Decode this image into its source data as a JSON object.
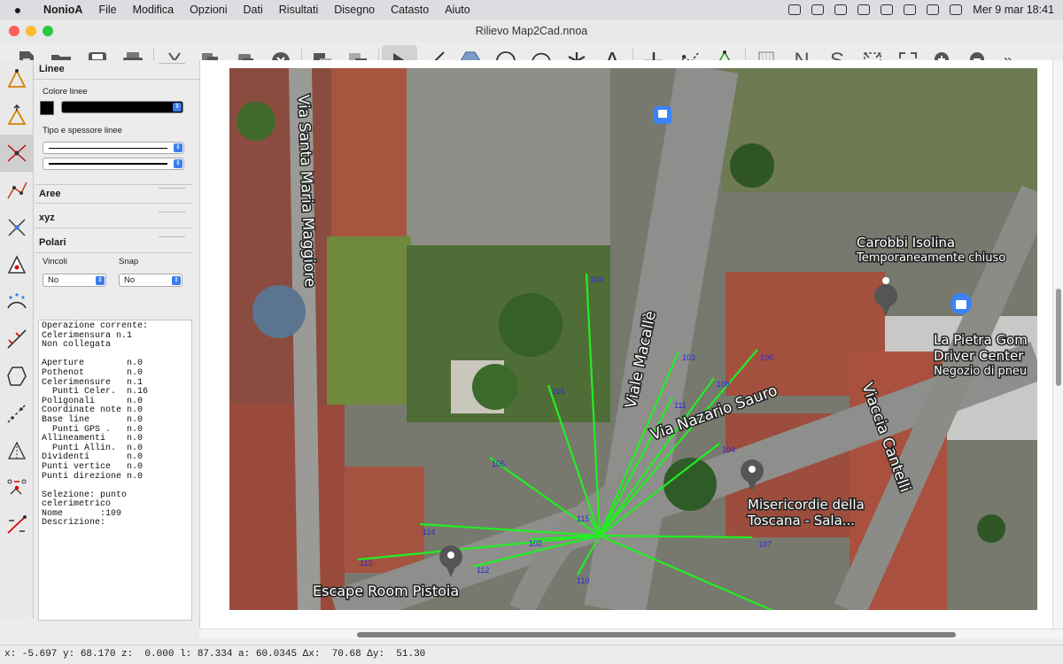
{
  "menubar": {
    "app": "NonioA",
    "items": [
      "File",
      "Modifica",
      "Opzioni",
      "Dati",
      "Risultati",
      "Disegno",
      "Catasto",
      "Aiuto"
    ],
    "clock": "Mer 9 mar  18:41"
  },
  "window": {
    "title": "Rilievo Map2Cad.nnoa"
  },
  "toolbar": {
    "icons": [
      "new-file-icon",
      "open-folder-icon",
      "save-icon",
      "print-icon",
      "cut-icon",
      "copy-icon",
      "paste-icon",
      "delete-icon",
      "layer-back-icon",
      "layer-front-icon",
      "pointer-icon",
      "line-icon",
      "polygon-icon",
      "circle-icon",
      "arc-icon",
      "asterisk-icon",
      "text-icon",
      "cross-icon",
      "traverse-icon",
      "triangulation-icon",
      "grid-icon",
      "north-icon",
      "south-icon",
      "fit-icon",
      "expand-icon",
      "zoom-in-icon",
      "zoom-out-icon",
      "more-icon"
    ],
    "text_icons": {
      "text": "A",
      "north": "N",
      "south": "S",
      "more": "»"
    }
  },
  "panel": {
    "lines_title": "Linee",
    "color_label": "Colore linee",
    "type_label": "Tipo e spessore linee",
    "areas_title": "Aree",
    "xyz_title": "xyz",
    "polar_title": "Polari",
    "constraints_label": "Vincoli",
    "snap_label": "Snap",
    "constraints_value": "No",
    "snap_value": "No",
    "info": "Operazione corrente:\nCelerimensura n.1\nNon collegata\n\nAperture        n.0\nPothenot        n.0\nCelerimensure   n.1\n  Punti Celer.  n.16\nPoligonali      n.0\nCoordinate note n.0\nBase line       n.0\n  Punti GPS .   n.0\nAllineamenti    n.0\n  Punti Allin.  n.0\nDividenti       n.0\nPunti vertice   n.0\nPunti direzione n.0\n\nSelezione: punto\ncelerimetrico\nNome       :109\nDescrizione:"
  },
  "map": {
    "streets": [
      "Via Santa Maria Maggiore",
      "Viale Macallè",
      "Via Nazario Sauro",
      "Viaccia Cantelli"
    ],
    "places": [
      {
        "name": "Carobbi Isolina",
        "sub": "Temporaneamente chiuso"
      },
      {
        "name": "La Pietra Gom",
        "sub": "Driver Center",
        "sub2": "Negozio di pneu"
      },
      {
        "name": "Misericordie della",
        "sub": "Toscana - Sala..."
      },
      {
        "name": "Escape Room Pistoia",
        "sub": ""
      }
    ],
    "points": [
      "101",
      "102",
      "103",
      "104",
      "105",
      "106",
      "107",
      "108",
      "109",
      "110",
      "111",
      "112",
      "113",
      "114",
      "115"
    ],
    "colors": {
      "survey_line": "#22ee22",
      "point_label": "#2a2ad8"
    }
  },
  "status": {
    "text": "x: -5.697 y: 68.170 z:  0.000 l: 87.334 a: 60.0345 Δx:  70.68 Δy:  51.30"
  }
}
